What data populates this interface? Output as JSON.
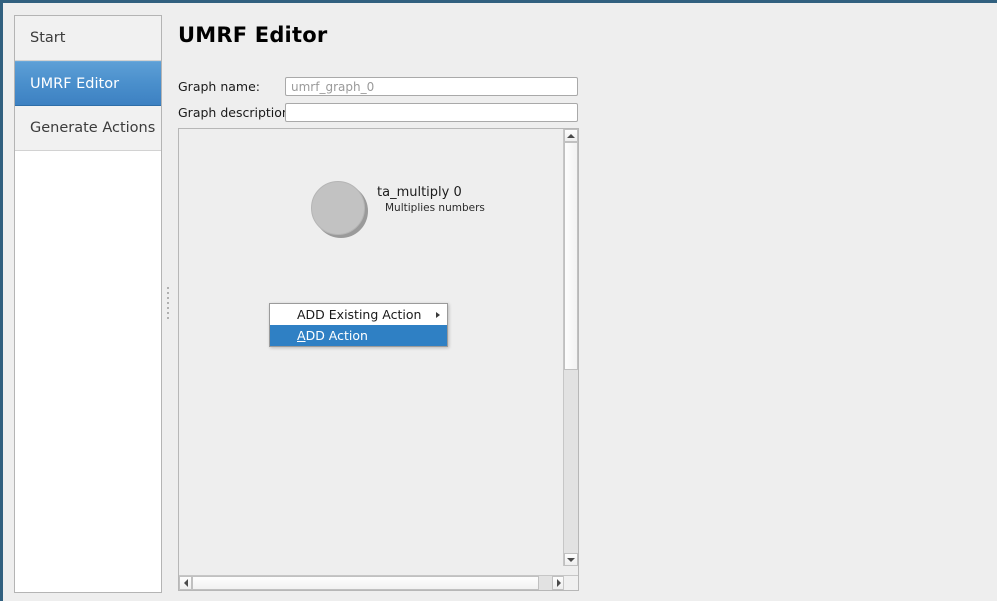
{
  "window": {
    "accent_border_color": "#31607f",
    "background_color": "#eeeeee"
  },
  "sidebar": {
    "items": [
      {
        "label": "Start",
        "selected": false
      },
      {
        "label": "UMRF Editor",
        "selected": true
      },
      {
        "label": "Generate Actions",
        "selected": false
      }
    ],
    "selected_color": "#4a8fcc"
  },
  "main": {
    "title": "UMRF Editor",
    "form": {
      "graph_name": {
        "label": "Graph name:",
        "value": "",
        "placeholder": "umrf_graph_0"
      },
      "graph_description": {
        "label": "Graph description:",
        "value": "",
        "placeholder": ""
      }
    },
    "graph": {
      "nodes": [
        {
          "title": "ta_multiply 0",
          "subtitle": "Multiplies numbers",
          "shape": "circle",
          "fill_color": "#c2c2c2"
        }
      ],
      "context_menu": {
        "items": [
          {
            "label": "ADD Existing Action",
            "mnemonic": "",
            "has_submenu": true,
            "highlighted": false
          },
          {
            "label_mnemonic": "A",
            "label_rest": "DD Action",
            "label": "ADD Action",
            "has_submenu": false,
            "highlighted": true
          }
        ],
        "highlight_color": "#2f80c4"
      },
      "scrollbars": {
        "vertical": {
          "up_arrow_icon": "triangle-up-icon",
          "down_arrow_icon": "triangle-down-icon"
        },
        "horizontal": {
          "left_arrow_icon": "triangle-left-icon",
          "right_arrow_icon": "triangle-right-icon"
        }
      }
    }
  }
}
